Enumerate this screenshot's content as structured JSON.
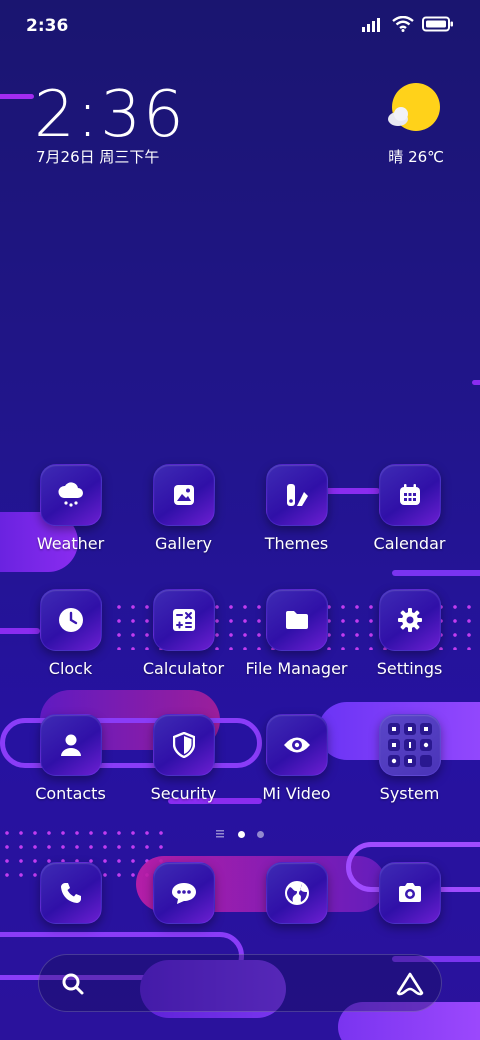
{
  "status_bar": {
    "time": "2:36",
    "signal_icon": "signal-bars-icon",
    "wifi_icon": "wifi-icon",
    "battery_icon": "battery-icon"
  },
  "clock_widget": {
    "time": "2:36",
    "date": "7月26日 周三下午"
  },
  "weather_widget": {
    "icon": "sun-cloud-icon",
    "text": "晴 26℃"
  },
  "apps": {
    "weather": "Weather",
    "gallery": "Gallery",
    "themes": "Themes",
    "calendar": "Calendar",
    "clock": "Clock",
    "calculator": "Calculator",
    "file_manager": "File Manager",
    "settings": "Settings",
    "contacts": "Contacts",
    "security": "Security",
    "mi_video": "Mi Video",
    "system": "System"
  },
  "dock": [
    "phone-icon",
    "messages-icon",
    "browser-icon",
    "camera-icon"
  ],
  "page_indicator": {
    "pages": 2,
    "active": 1
  },
  "search": {
    "left_icon": "search-icon",
    "right_icon": "assistant-icon"
  },
  "colors": {
    "background": "#22158f",
    "accent_purple": "#8a2cf0",
    "accent_magenta": "#c23cf0",
    "weather_sun": "#ffd21a"
  }
}
